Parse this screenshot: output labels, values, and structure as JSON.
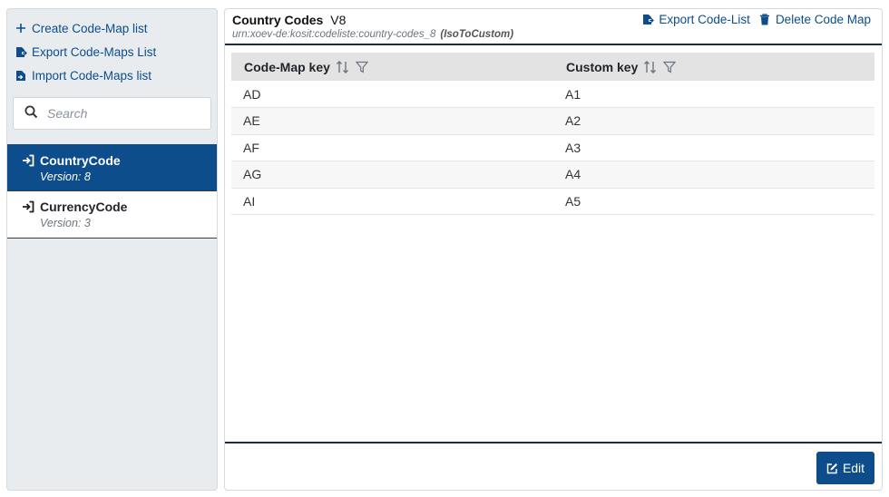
{
  "sidebar": {
    "actions": [
      {
        "label": "Create Code-Map list",
        "icon": "plus-icon"
      },
      {
        "label": "Export Code-Maps List",
        "icon": "file-export-icon"
      },
      {
        "label": "Import Code-Maps list",
        "icon": "file-import-icon"
      }
    ],
    "search": {
      "placeholder": "Search",
      "value": ""
    },
    "items": [
      {
        "title": "CountryCode",
        "version": "Version: 8",
        "selected": true
      },
      {
        "title": "CurrencyCode",
        "version": "Version: 3",
        "selected": false
      }
    ]
  },
  "detail": {
    "title": "Country Codes",
    "version": "V8",
    "urn": "urn:xoev-de:kosit:codeliste:country-codes_8",
    "mapping": "(IsoToCustom)",
    "actions": {
      "export": "Export Code-List",
      "delete": "Delete Code Map"
    },
    "table": {
      "columns": [
        "Code-Map key",
        "Custom key"
      ],
      "rows": [
        [
          "AD",
          "A1"
        ],
        [
          "AE",
          "A2"
        ],
        [
          "AF",
          "A3"
        ],
        [
          "AG",
          "A4"
        ],
        [
          "AI",
          "A5"
        ]
      ]
    },
    "edit_label": "Edit"
  },
  "colors": {
    "primary": "#0d4d8c",
    "panel_bg": "#e9ecef",
    "header_row_bg": "#e3e3e3"
  }
}
